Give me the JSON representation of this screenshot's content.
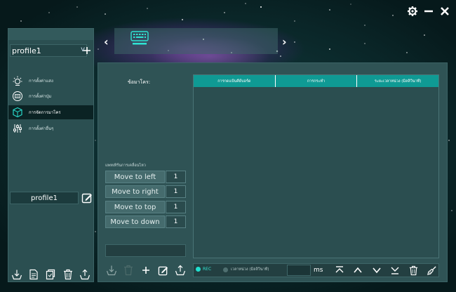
{
  "window": {
    "settings_icon": "gear-icon",
    "minimize_icon": "minimize-icon",
    "close_icon": "close-icon"
  },
  "sidebar": {
    "profile_select_value": "profile1",
    "add_icon": "plus-icon",
    "items": [
      {
        "label": "การตั้งค่าแสง",
        "icon": "light-icon",
        "active": false
      },
      {
        "label": "การตั้งค่าปุ่ม",
        "icon": "keys-icon",
        "active": false
      },
      {
        "label": "การจัดการมาโคร",
        "icon": "macro-icon",
        "active": true
      },
      {
        "label": "การตั้งค่าอื่นๆ",
        "icon": "sliders-icon",
        "active": false
      }
    ],
    "profile_name": "profile1",
    "tools": [
      "import-icon",
      "document-icon",
      "copy-icon",
      "trash-icon",
      "export-icon"
    ]
  },
  "device_bar": {
    "prev_label": "‹",
    "next_label": "›",
    "device_icon": "keyboard-icon"
  },
  "macro": {
    "list_label": "ข้อมาโคร:",
    "loop_label": "แพทเทิร์นการเคลื่อนไหว",
    "moves": [
      {
        "label": "Move to left",
        "count": "1"
      },
      {
        "label": "Move to right",
        "count": "1"
      },
      {
        "label": "Move to top",
        "count": "1"
      },
      {
        "label": "Move to down",
        "count": "1"
      }
    ],
    "columns": [
      "การกดแป้นคีย์บอร์ด",
      "การกระทำ",
      "ระยะเวลาหน่วง (มิลลิวินาที)"
    ],
    "rec_label": "REC",
    "delay_label": "เวลาหน่วง (มิลลิวินาที)",
    "ms_label": "ms"
  }
}
